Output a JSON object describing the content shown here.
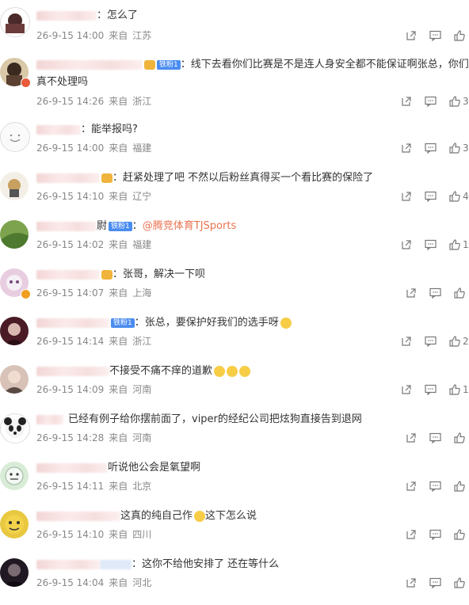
{
  "comments": [
    {
      "text": "：怎么了",
      "fan": "",
      "crown": false,
      "time": "26-9-15 14:00",
      "from": "来自",
      "loc": "江苏",
      "likes": "",
      "avatar_color": "#8a4b4b",
      "badge": false
    },
    {
      "text": "：线下去看你们比赛是不是连人身安全都不能保证啊张总，你们",
      "text2": "真不处理吗",
      "fan": "铁粉1",
      "crown": true,
      "time": "26-9-15 14:26",
      "from": "来自",
      "loc": "浙江",
      "likes": "3",
      "avatar_color": "#3b2a20",
      "badge": true
    },
    {
      "text": "：能举报吗?",
      "fan": "",
      "crown": false,
      "time": "26-9-15 14:00",
      "from": "来自",
      "loc": "福建",
      "likes": "3",
      "avatar_color": "#f2f2f2",
      "badge": false
    },
    {
      "text": "：赶紧处理了吧 不然以后粉丝真得买一个看比赛的保险了",
      "fan": "",
      "crown": true,
      "time": "26-9-15 14:10",
      "from": "来自",
      "loc": "辽宁",
      "likes": "4",
      "avatar_color": "#c8b48c",
      "badge": false
    },
    {
      "text": "：",
      "link": "@腾竞体育TJSports",
      "name_tail": "尉",
      "fan": "铁粉1",
      "crown": false,
      "time": "26-9-15 14:02",
      "from": "来自",
      "loc": "福建",
      "likes": "1",
      "avatar_color": "#7da34e",
      "badge": false
    },
    {
      "text": "：张哥，解决一下呗",
      "fan": "",
      "crown": true,
      "time": "26-9-15 14:07",
      "from": "来自",
      "loc": "上海",
      "likes": "",
      "avatar_color": "#d9a7c7",
      "badge": true
    },
    {
      "text": "：张总，要保护好我们的选手呀",
      "fan": "铁粉1",
      "crown": false,
      "emoji": true,
      "time": "26-9-15 14:14",
      "from": "来自",
      "loc": "浙江",
      "likes": "2",
      "avatar_color": "#7a2b35",
      "badge": false
    },
    {
      "text": "不接受不痛不痒的道歉",
      "fan": "",
      "crown": false,
      "emoji3": true,
      "time": "26-9-15 14:09",
      "from": "来自",
      "loc": "河南",
      "likes": "1",
      "avatar_color": "#b79a8c",
      "badge": false
    },
    {
      "text": "已经有例子给你摆前面了，viper的经纪公司把炫狗直接告到退网",
      "fan": "",
      "crown": false,
      "time": "26-9-15 14:28",
      "from": "来自",
      "loc": "河南",
      "likes": "",
      "avatar_color": "#2e2e2e",
      "badge": false
    },
    {
      "text": "听说他公会是氧望啊",
      "fan": "",
      "crown": false,
      "time": "26-9-15 14:11",
      "from": "来自",
      "loc": "北京",
      "likes": "",
      "avatar_color": "#cfe6cf",
      "badge": false
    },
    {
      "text": "这真的纯自己作",
      "text_after": "这下怎么说",
      "emoji_mid": true,
      "fan": "",
      "crown": false,
      "time": "26-9-15 14:10",
      "from": "来自",
      "loc": "四川",
      "likes": "",
      "avatar_color": "#d8b53a",
      "badge": false
    },
    {
      "text": "：这你不给他安排了 还在等什么",
      "fan": "",
      "crown": false,
      "fan_faint": true,
      "time": "26-9-15 14:04",
      "from": "来自",
      "loc": "河北",
      "likes": "",
      "avatar_color": "#201822",
      "badge": false
    }
  ]
}
